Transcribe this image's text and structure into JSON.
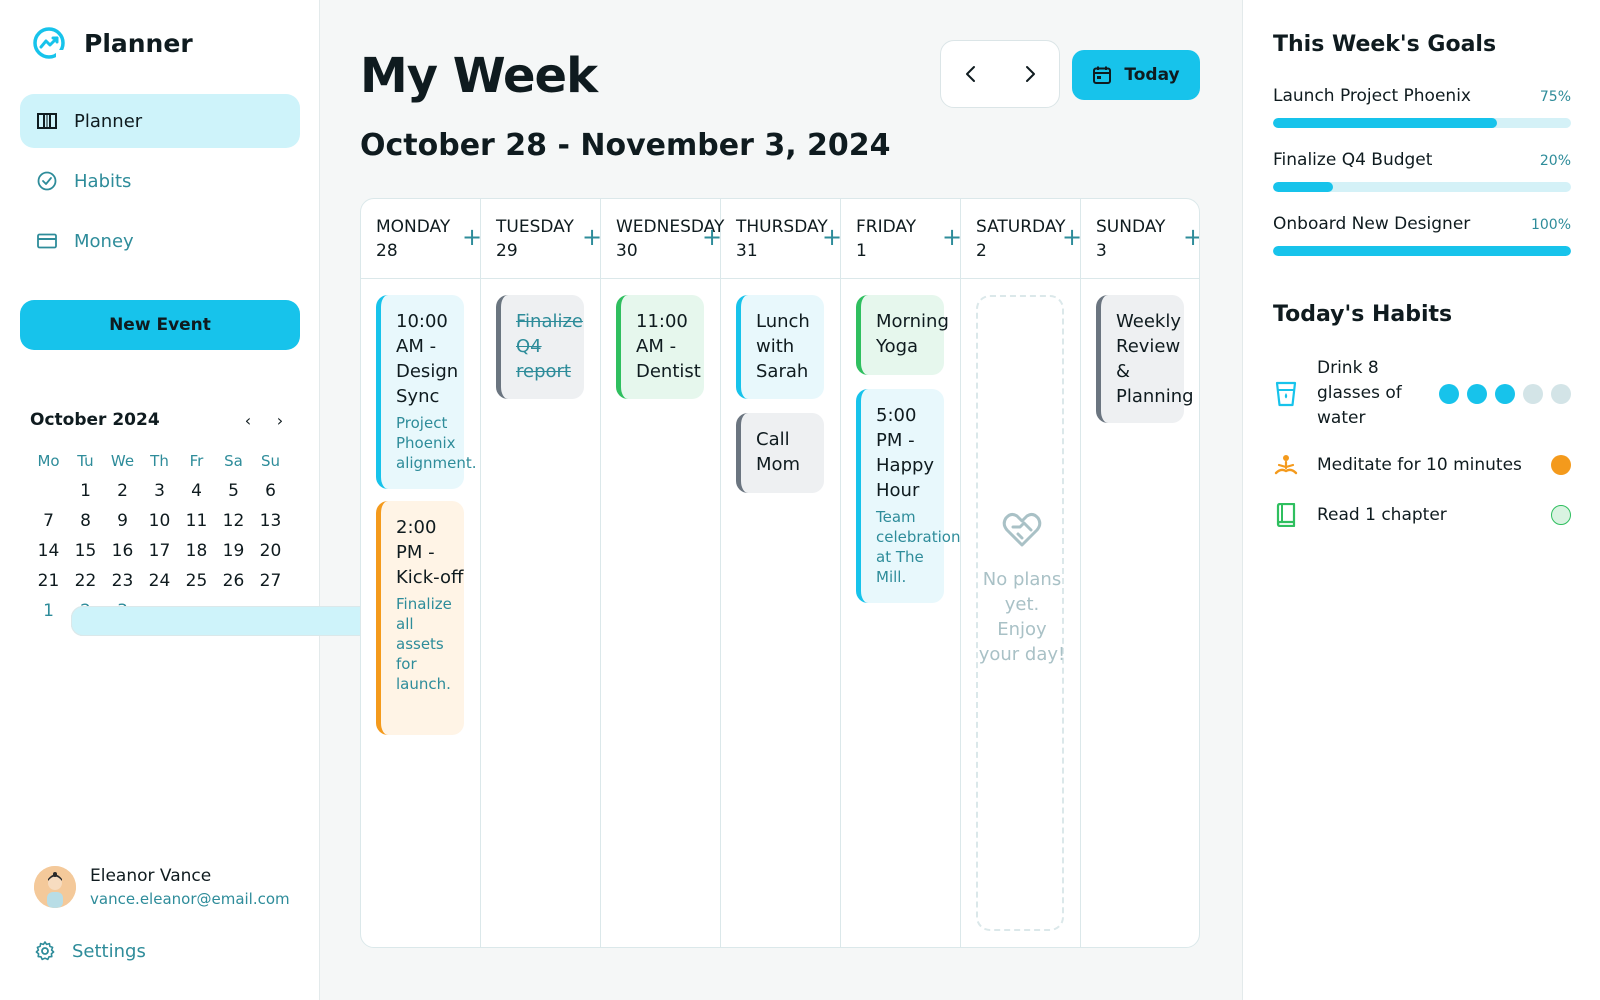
{
  "sidebar": {
    "brand": "Planner",
    "nav": [
      {
        "label": "Planner",
        "icon": "columns-icon",
        "active": true
      },
      {
        "label": "Habits",
        "icon": "check-circle-icon",
        "active": false
      },
      {
        "label": "Money",
        "icon": "credit-card-icon",
        "active": false
      }
    ],
    "new_event_label": "New Event",
    "mini_calendar": {
      "title": "October 2024",
      "weekdays": [
        "Mo",
        "Tu",
        "We",
        "Th",
        "Fr",
        "Sa",
        "Su"
      ],
      "days": [
        "",
        "1",
        "2",
        "3",
        "4",
        "5",
        "6",
        "7",
        "8",
        "9",
        "10",
        "11",
        "12",
        "13",
        "14",
        "15",
        "16",
        "17",
        "18",
        "19",
        "20",
        "21",
        "22",
        "23",
        "24",
        "25",
        "26",
        "27",
        "28",
        "29",
        "30",
        "31",
        "1",
        "2",
        "3"
      ]
    },
    "user": {
      "name": "Eleanor Vance",
      "email": "vance.eleanor@email.com"
    },
    "settings_label": "Settings"
  },
  "main": {
    "title": "My Week",
    "today_label": "Today",
    "date_range": "October 28 - November 3, 2024",
    "days": [
      {
        "name": "MONDAY",
        "num": "28"
      },
      {
        "name": "TUESDAY",
        "num": "29"
      },
      {
        "name": "WEDNESDAY",
        "num": "30"
      },
      {
        "name": "THURSDAY",
        "num": "31"
      },
      {
        "name": "FRIDAY",
        "num": "1"
      },
      {
        "name": "SATURDAY",
        "num": "2"
      },
      {
        "name": "SUNDAY",
        "num": "3"
      }
    ],
    "add_symbol": "+",
    "events": {
      "mon_1": {
        "title": "10:00 AM - Design Sync",
        "sub": "Project Phoenix alignment."
      },
      "mon_2": {
        "title": "2:00 PM - Kick-off",
        "sub": "Finalize all assets for launch."
      },
      "tue_1": {
        "title": "Finalize Q4 report"
      },
      "wed_1": {
        "title": "11:00 AM - Dentist"
      },
      "thu_1": {
        "title": "Lunch with Sarah"
      },
      "thu_2": {
        "title": "Call Mom"
      },
      "fri_1": {
        "title": "Morning Yoga"
      },
      "fri_2": {
        "title": "5:00 PM - Happy Hour",
        "sub": "Team celebration at The Mill."
      },
      "sun_1": {
        "title": "Weekly Review & Planning"
      }
    },
    "empty_saturday": "No plans yet. Enjoy your day!"
  },
  "right": {
    "goals_title": "This Week's Goals",
    "goals": [
      {
        "name": "Launch Project Phoenix",
        "pct": "75%",
        "progress": 0.75
      },
      {
        "name": "Finalize Q4 Budget",
        "pct": "20%",
        "progress": 0.2
      },
      {
        "name": "Onboard New Designer",
        "pct": "100%",
        "progress": 1.0
      }
    ],
    "habits_title": "Today's Habits",
    "habits": [
      {
        "label": "Drink 8 glasses of water",
        "icon": "glass-icon",
        "done": 3,
        "total": 5
      },
      {
        "label": "Meditate for 10 minutes",
        "icon": "meditation-icon",
        "done": 1,
        "total": 1
      },
      {
        "label": "Read 1 chapter",
        "icon": "book-icon",
        "done": 0,
        "total": 1
      }
    ]
  },
  "colors": {
    "accent": "#17c3eb",
    "accent_light": "#cef3fa",
    "teal_text": "#2e8c9a",
    "orange": "#f49a1c",
    "green": "#2fbf5f"
  }
}
